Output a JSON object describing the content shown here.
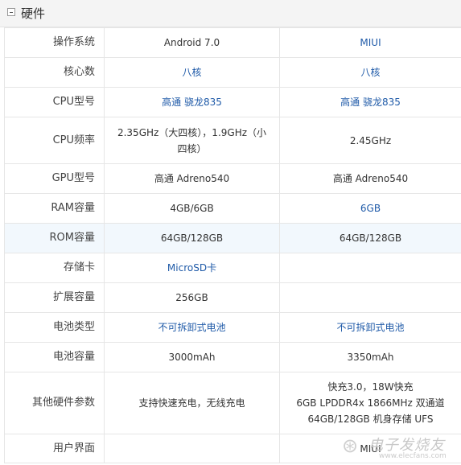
{
  "section": {
    "title": "硬件",
    "toggle_icon": "minus-box-icon"
  },
  "rows": [
    {
      "label": "操作系统",
      "c1": "Android 7.0",
      "c2": "MIUI"
    },
    {
      "label": "核心数",
      "c1": "八核",
      "c2": "八核"
    },
    {
      "label": "CPU型号",
      "c1": "高通 骁龙835",
      "c2": "高通 骁龙835"
    },
    {
      "label": "CPU频率",
      "c1": "2.35GHz（大四核），1.9GHz（小四核）",
      "c2": "2.45GHz"
    },
    {
      "label": "GPU型号",
      "c1": "高通 Adreno540",
      "c2": "高通 Adreno540"
    },
    {
      "label": "RAM容量",
      "c1": "4GB/6GB",
      "c2": "6GB"
    },
    {
      "label": "ROM容量",
      "c1": "64GB/128GB",
      "c2": "64GB/128GB"
    },
    {
      "label": "存储卡",
      "c1": "MicroSD卡",
      "c2": ""
    },
    {
      "label": "扩展容量",
      "c1": "256GB",
      "c2": ""
    },
    {
      "label": "电池类型",
      "c1": "不可拆卸式电池",
      "c2": "不可拆卸式电池"
    },
    {
      "label": "电池容量",
      "c1": "3000mAh",
      "c2": "3350mAh"
    },
    {
      "label": "其他硬件参数",
      "c1": "支持快速充电，无线充电",
      "c2": [
        "快充3.0，18W快充",
        "6GB LPDDR4x 1866MHz 双通道",
        "64GB/128GB 机身存储 UFS"
      ]
    },
    {
      "label": "用户界面",
      "c1": "",
      "c2": "MIUI"
    }
  ],
  "watermark": {
    "main": "电子发烧友",
    "url": "www.elecfans.com",
    "logo_icon": "elecfans-logo-icon"
  },
  "colors": {
    "link_blue": "#1f5aa8",
    "highlight_row": "#f2f8fd",
    "border": "#e6e6e6",
    "header_bg": "#f4f4f4"
  }
}
